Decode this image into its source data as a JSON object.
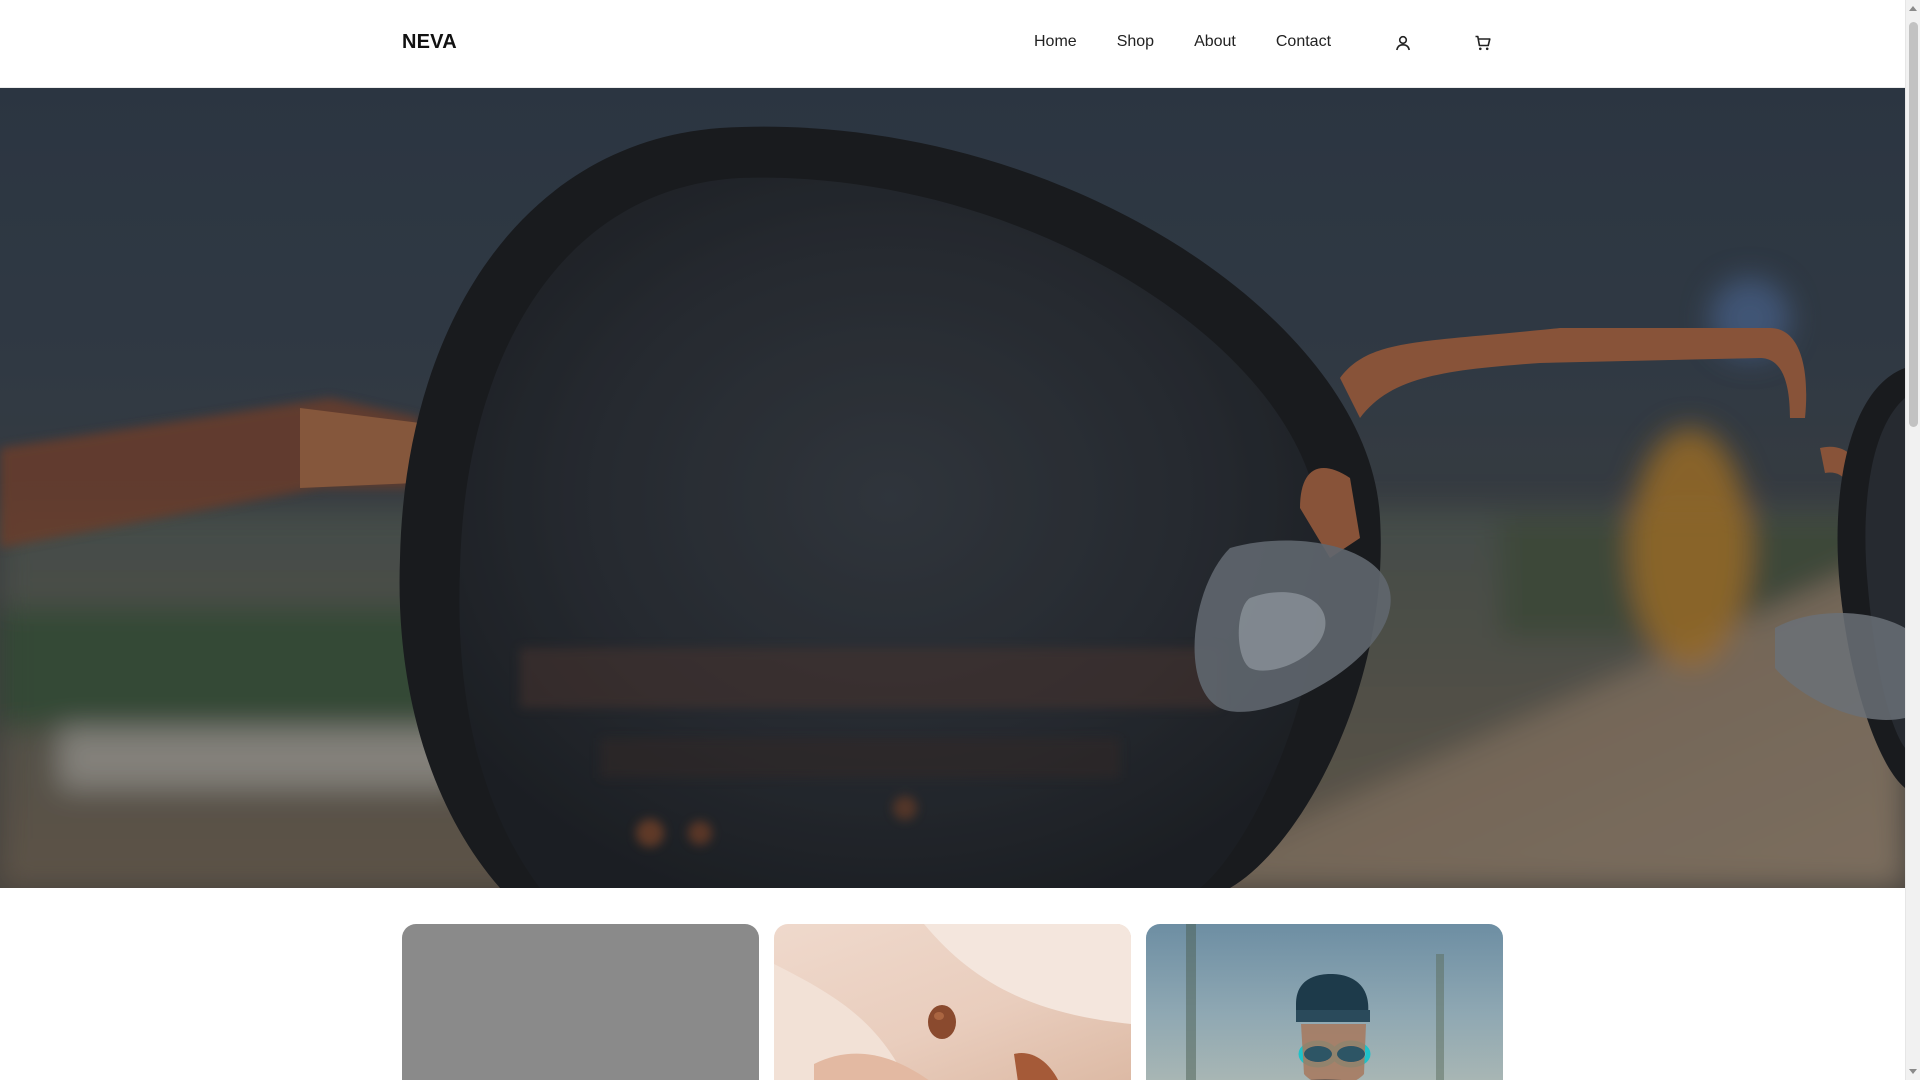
{
  "header": {
    "logo": "NEVA",
    "nav": [
      "Home",
      "Shop",
      "About",
      "Contact"
    ],
    "account_icon": "user-icon",
    "cart_icon": "shopping-cart-icon"
  },
  "hero": {
    "image": "close-up of round tortoiseshell sunglasses lens with blurred street background",
    "overlay_color": "#14181e"
  },
  "cards": [
    {
      "image": "grey product photo"
    },
    {
      "image": "hands holding item in beige coat"
    },
    {
      "image": "person wearing blue beanie and teal sunglasses"
    }
  ],
  "colors": {
    "header_bg": "#ffffff",
    "text": "#1f1f1f",
    "hero_tint": "#344150"
  }
}
